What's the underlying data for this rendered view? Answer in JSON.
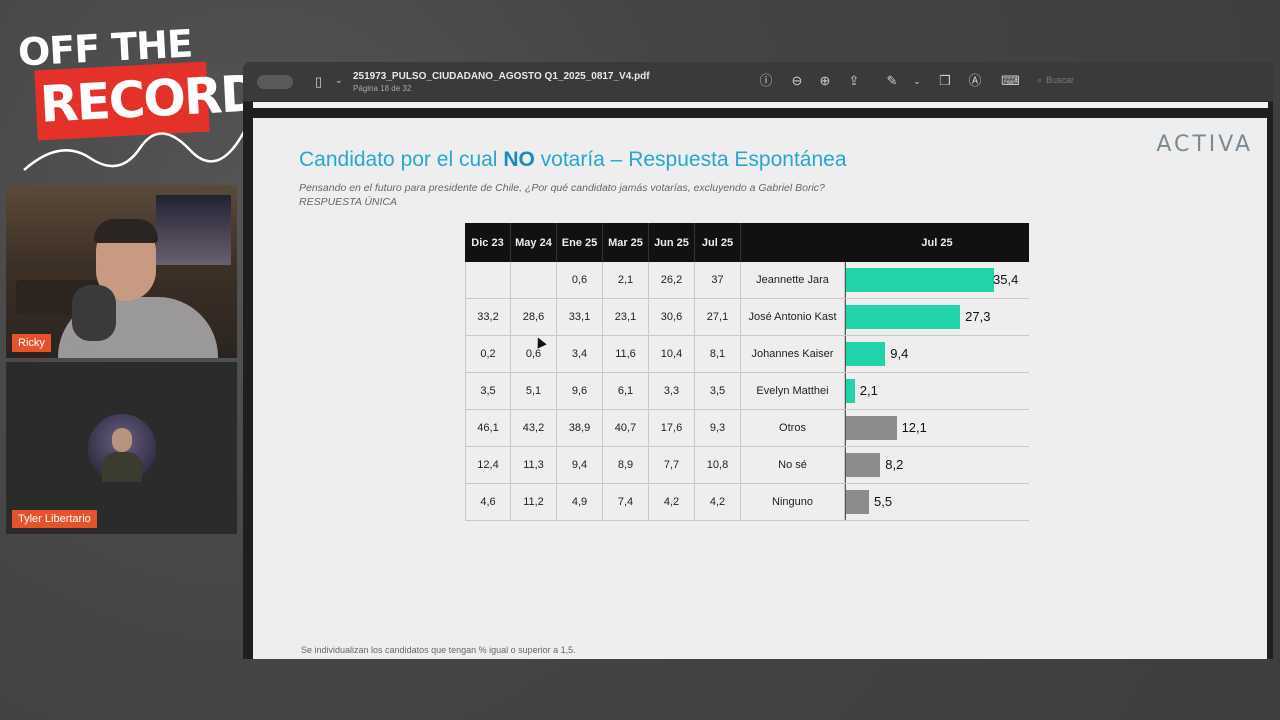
{
  "logo": {
    "line1": "OFF THE",
    "line2": "RECORD"
  },
  "cams": [
    {
      "name": "Ricky"
    },
    {
      "name": "Tyler Libertario"
    }
  ],
  "viewer": {
    "doc_title": "251973_PULSO_CIUDADANO_AGOSTO Q1_2025_0817_V4.pdf",
    "page_info": "Página 18 de 32",
    "search_placeholder": "Buscar",
    "icons": [
      "info-icon",
      "zoom-out-icon",
      "zoom-in-icon",
      "share-icon",
      "pen-icon",
      "chevron-down-icon",
      "window-icon",
      "markup-icon",
      "form-icon"
    ]
  },
  "slide": {
    "title_pre": "Candidato por el cual ",
    "title_bold": "NO",
    "title_post": " votaría – Respuesta Espontánea",
    "brand": "ACTIVA",
    "subtitle": "Pensando en el futuro para presidente de Chile, ¿Por qué candidato jamás votarías, excluyendo a Gabriel Boric?",
    "subtitle2": "RESPUESTA ÚNICA",
    "footnote": "Se individualizan los candidatos que tengan % igual o superior a 1,5."
  },
  "table": {
    "headers": [
      "Dic 23",
      "May 24",
      "Ene 25",
      "Mar 25",
      "Jun 25",
      "Jul 25",
      "",
      "Jul 25"
    ],
    "rows": [
      {
        "cells": [
          "",
          "",
          "0,6",
          "2,1",
          "26,2",
          "37"
        ],
        "name": "Jeannette Jara",
        "bar_label": "35,4"
      },
      {
        "cells": [
          "33,2",
          "28,6",
          "33,1",
          "23,1",
          "30,6",
          "27,1"
        ],
        "name": "José Antonio Kast",
        "bar_label": "27,3"
      },
      {
        "cells": [
          "0,2",
          "0,6",
          "3,4",
          "11,6",
          "10,4",
          "8,1"
        ],
        "name": "Johannes Kaiser",
        "bar_label": "9,4"
      },
      {
        "cells": [
          "3,5",
          "5,1",
          "9,6",
          "6,1",
          "3,3",
          "3,5"
        ],
        "name": "Evelyn Matthei",
        "bar_label": "2,1"
      },
      {
        "cells": [
          "46,1",
          "43,2",
          "38,9",
          "40,7",
          "17,6",
          "9,3"
        ],
        "name": "Otros",
        "bar_label": "12,1"
      },
      {
        "cells": [
          "12,4",
          "11,3",
          "9,4",
          "8,9",
          "7,7",
          "10,8"
        ],
        "name": "No sé",
        "bar_label": "8,2"
      },
      {
        "cells": [
          "4,6",
          "11,2",
          "4,9",
          "7,4",
          "4,2",
          "4,2"
        ],
        "name": "Ninguno",
        "bar_label": "5,5"
      }
    ]
  },
  "chart_data": {
    "type": "bar",
    "categories": [
      "Jeannette Jara",
      "José Antonio Kast",
      "Johannes Kaiser",
      "Evelyn Matthei",
      "Otros",
      "No sé",
      "Ninguno"
    ],
    "values": [
      35.4,
      27.3,
      9.4,
      2.1,
      12.1,
      8.2,
      5.5
    ],
    "title": "Jul 25",
    "colors": [
      "#22d3aa",
      "#22d3aa",
      "#22d3aa",
      "#22d3aa",
      "#8c8c8c",
      "#8c8c8c",
      "#8c8c8c"
    ],
    "xlim": [
      0,
      36
    ],
    "orientation": "horizontal"
  }
}
